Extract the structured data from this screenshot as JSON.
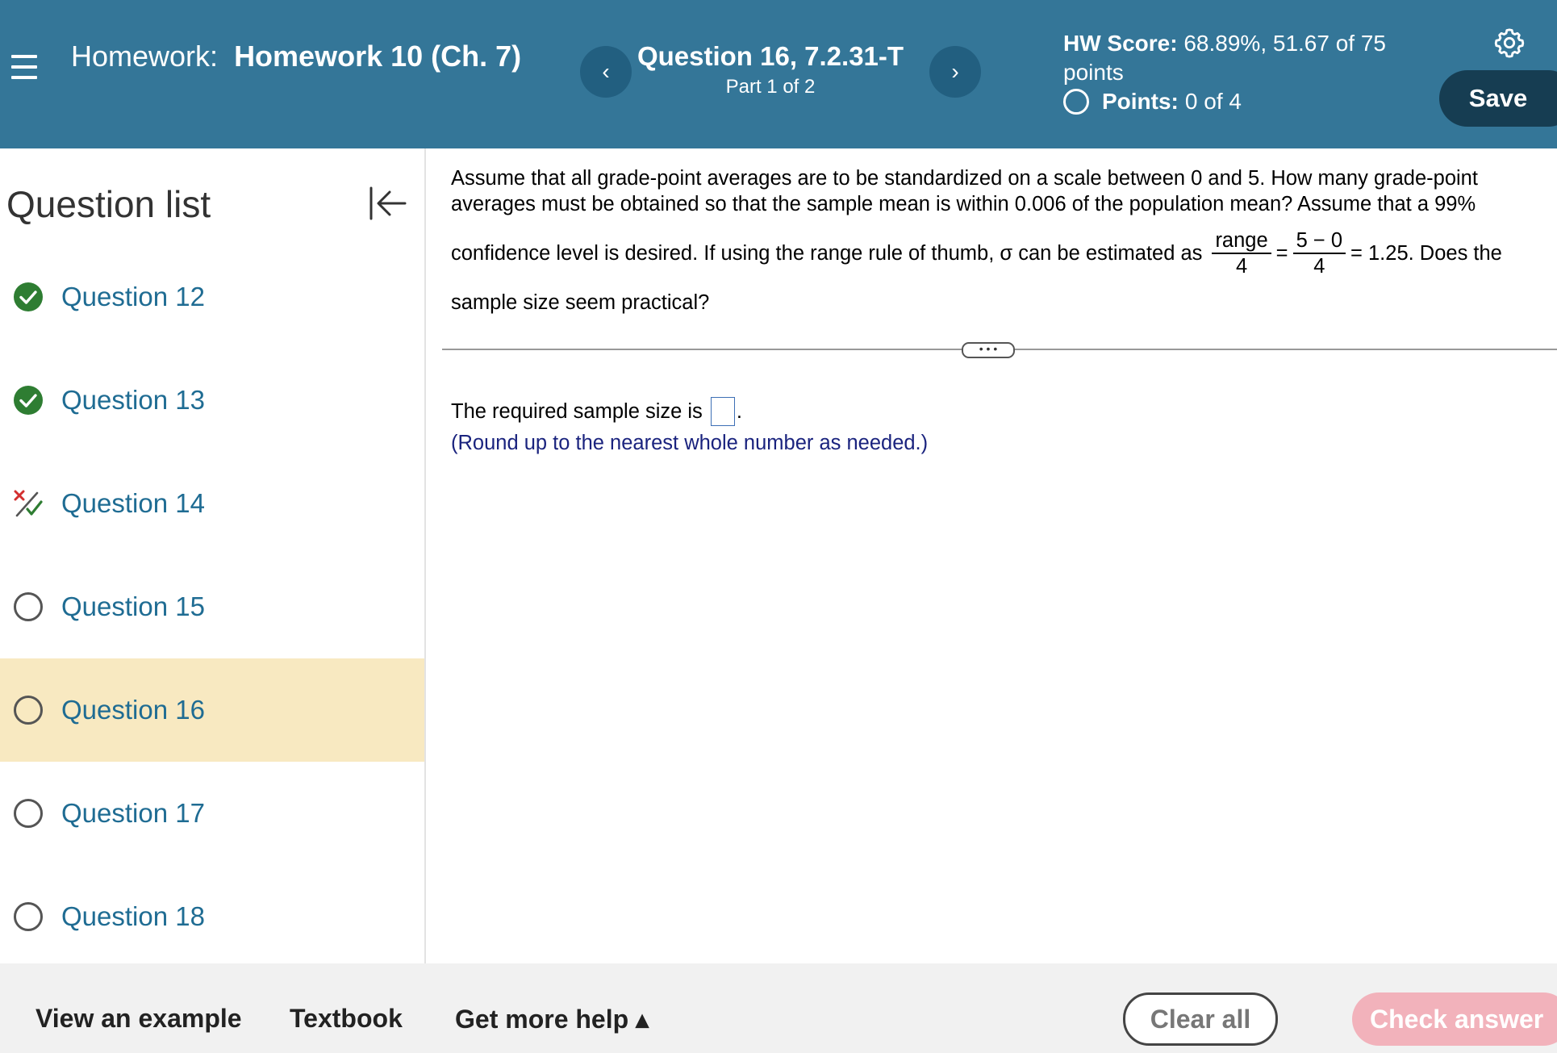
{
  "header": {
    "hw_label": "Homework:",
    "hw_name": "Homework 10 (Ch. 7)",
    "question_title": "Question 16, 7.2.31-T",
    "question_part": "Part 1 of 2",
    "score_label": "HW Score:",
    "score_value": "68.89%, 51.67 of 75 points",
    "points_label": "Points:",
    "points_value": "0 of 4",
    "save_label": "Save",
    "prev_symbol": "‹",
    "next_symbol": "›",
    "icons": {
      "menu": "hamburger-menu-icon",
      "settings": "gear-icon"
    },
    "colors": {
      "background": "#347698",
      "nav_button": "#225f80",
      "save_button": "#163d52"
    }
  },
  "sidebar": {
    "title": "Question list",
    "items": [
      {
        "label": "Question 12",
        "status": "correct"
      },
      {
        "label": "Question 13",
        "status": "correct"
      },
      {
        "label": "Question 14",
        "status": "partial"
      },
      {
        "label": "Question 15",
        "status": "unanswered"
      },
      {
        "label": "Question 16",
        "status": "unanswered",
        "active": true
      },
      {
        "label": "Question 17",
        "status": "unanswered"
      },
      {
        "label": "Question 18",
        "status": "unanswered"
      }
    ],
    "colors": {
      "active_background": "#f8e9c1",
      "correct": "#2e7d32",
      "link": "#1f6c93"
    }
  },
  "question": {
    "line1": "Assume that all grade-point averages are to be standardized on a scale between 0 and 5. How many grade-point",
    "line2": "averages must be obtained so that the sample mean is within 0.006 of the population mean? Assume that a 99%",
    "line3_prefix": "confidence level is desired. If using the range rule of thumb, σ can be estimated as",
    "frac1_num": "range",
    "frac1_den": "4",
    "equals": "=",
    "frac2_num": "5 − 0",
    "frac2_den": "4",
    "line3_suffix": "= 1.25. Does the",
    "line4": "sample size seem practical?",
    "more_label": "• • •",
    "answer_prefix": "The required sample size is",
    "answer_suffix": ".",
    "answer_value": "",
    "answer_note": "(Round up to the nearest whole number as needed.)"
  },
  "footer": {
    "view_example": "View an example",
    "textbook": "Textbook",
    "get_more_help": "Get more help ▴",
    "clear_all": "Clear all",
    "check_answer": "Check answer",
    "colors": {
      "check_button": "#f2b2bb"
    }
  }
}
